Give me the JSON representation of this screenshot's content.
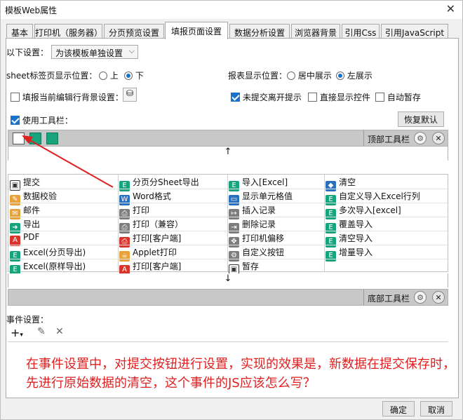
{
  "window": {
    "title": "模板Web属性",
    "close_glyph": "✕"
  },
  "tabs": [
    "基本",
    "打印机（服务器）",
    "分页预览设置",
    "填报页面设置",
    "数据分析设置",
    "浏览器背景",
    "引用Css",
    "引用JavaScript"
  ],
  "active_tab": "填报页面设置",
  "settings": {
    "following_label": "以下设置：",
    "template_select": "为该模板单独设置",
    "sheet_tab_position_label": "sheet标签页显示位置：",
    "sheet_tab_position_options": [
      "上",
      "下"
    ],
    "sheet_tab_position_selected": "下",
    "report_position_label": "报表显示位置：",
    "report_position_options": [
      "居中展示",
      "左展示"
    ],
    "report_position_selected": "左展示",
    "fill_bg_label": "填报当前编辑行背景设置：",
    "fill_bg_checked": false,
    "unsubmitted_prompt_label": "未提交离开提示",
    "unsubmitted_prompt_checked": true,
    "direct_show_label": "直接显示控件",
    "direct_show_checked": false,
    "autosave_label": "自动暂存",
    "autosave_checked": false,
    "use_toolbar_label": "使用工具栏：",
    "use_toolbar_checked": true,
    "restore_default": "恢复默认"
  },
  "top_toolbar": {
    "label": "顶部工具栏"
  },
  "bottom_toolbar": {
    "label": "底部工具栏"
  },
  "grid": {
    "columns": [
      [
        {
          "icon": "save-icon",
          "label": "提交"
        },
        {
          "icon": "pencil-icon",
          "label": "数据校验"
        },
        {
          "icon": "mail-icon",
          "label": "邮件"
        },
        {
          "icon": "export-icon",
          "label": "导出"
        },
        {
          "icon": "pdf-icon",
          "label": "PDF"
        },
        {
          "icon": "excel-icon",
          "label": "Excel(分页导出)"
        },
        {
          "icon": "excel-icon",
          "label": "Excel(原样导出)"
        }
      ],
      [
        {
          "icon": "excel-icon",
          "label": "分页分Sheet导出"
        },
        {
          "icon": "word-icon",
          "label": "Word格式"
        },
        {
          "icon": "printer-icon",
          "label": "打印"
        },
        {
          "icon": "printer-icon",
          "label": "打印（兼容）"
        },
        {
          "icon": "client-print-icon",
          "label": "打印[客户端]"
        },
        {
          "icon": "applet-icon",
          "label": "Applet打印"
        },
        {
          "icon": "pdf-icon",
          "label": "打印[客户端]"
        }
      ],
      [
        {
          "icon": "excel-icon",
          "label": "导入[Excel]"
        },
        {
          "icon": "cell-icon",
          "label": "显示单元格值"
        },
        {
          "icon": "insert-row-icon",
          "label": "插入记录"
        },
        {
          "icon": "delete-row-icon",
          "label": "删除记录"
        },
        {
          "icon": "move-icon",
          "label": "打印机偏移"
        },
        {
          "icon": "gear-icon",
          "label": "自定义按钮"
        },
        {
          "icon": "save-icon",
          "label": "暂存"
        }
      ],
      [
        {
          "icon": "eraser-icon",
          "label": "清空"
        },
        {
          "icon": "excel-icon",
          "label": "自定义导入Excel行列"
        },
        {
          "icon": "excel-icon",
          "label": "多次导入[excel]"
        },
        {
          "icon": "excel-icon",
          "label": "覆盖导入"
        },
        {
          "icon": "excel-icon",
          "label": "清空导入"
        },
        {
          "icon": "excel-icon",
          "label": "增量导入"
        }
      ]
    ]
  },
  "events": {
    "label": "事件设置："
  },
  "annotation": "在事件设置中，对提交按钮进行设置，实现的效果是，新数据在提交保存时，先进行原始数据的清空，这个事件的JS应该怎么写？",
  "footer": {
    "ok": "确定",
    "cancel": "取消"
  },
  "colors": {
    "annotation": "#e02020",
    "accent": "#1a73c8",
    "excel_green": "#17a37c"
  }
}
